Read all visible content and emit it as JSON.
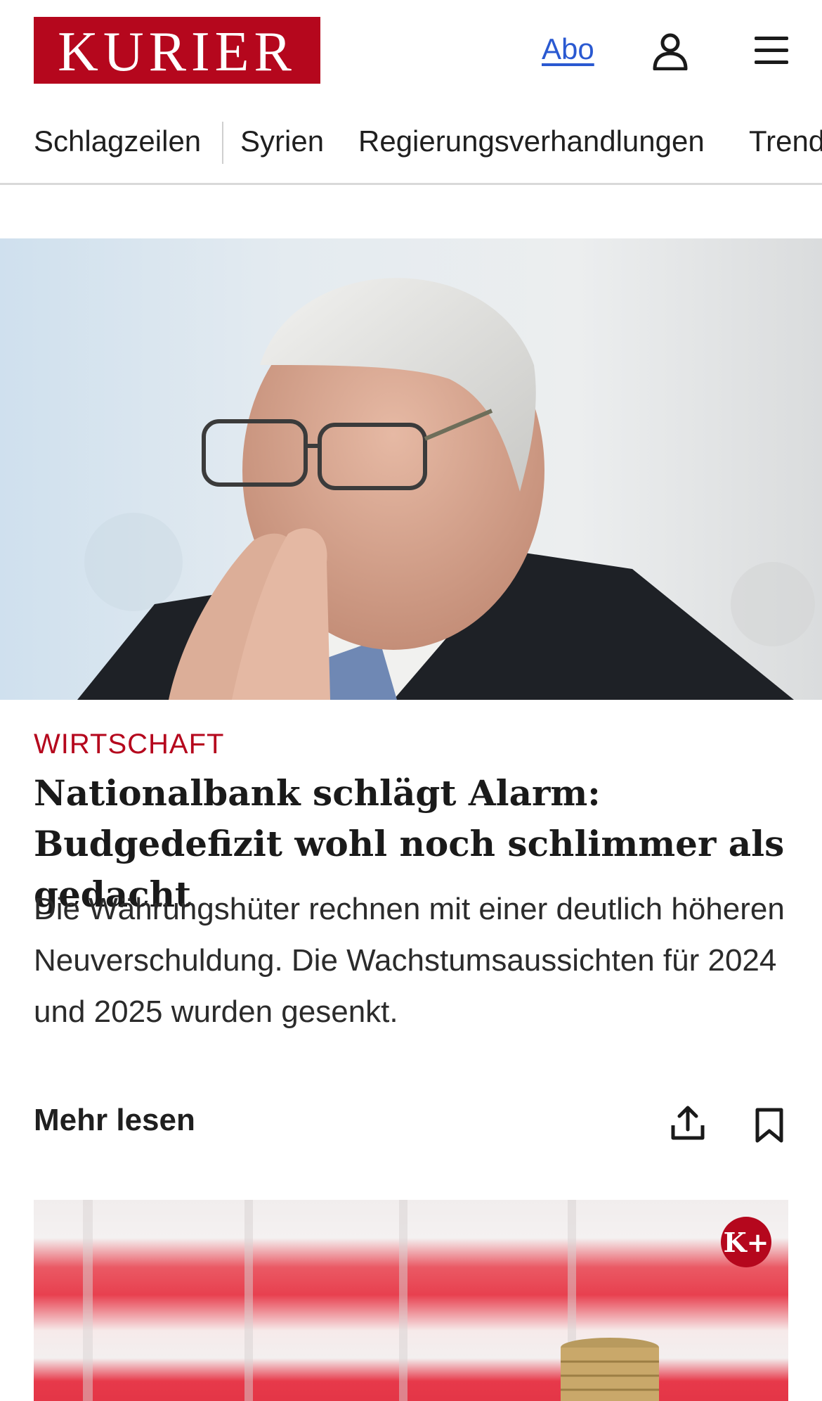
{
  "header": {
    "logo_text": "KURIER",
    "abo_label": "Abo",
    "brand_color": "#b5071d"
  },
  "nav": {
    "items": [
      "Schlagzeilen",
      "Syrien",
      "Regierungsverhandlungen",
      "Trends"
    ]
  },
  "article": {
    "section": "WIRTSCHAFT",
    "headline": "Nationalbank schlägt Alarm: Budgedefizit wohl noch schlimmer als gedacht",
    "teaser": "Die Währungshüter rechnen mit einer deutlich höheren Neuverschuldung. Die Wachstumsaussichten für 2024 und 2025 wurden gesenkt.",
    "more_label": "Mehr lesen"
  },
  "card2": {
    "badge": "K+"
  }
}
